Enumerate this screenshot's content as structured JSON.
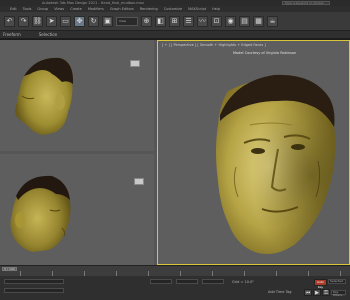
{
  "window": {
    "title": "Autodesk 3ds Max Design 2011 - Head_final_mudbox.max",
    "search_placeholder": "Type a keyword or phrase"
  },
  "menubar": [
    "Edit",
    "Tools",
    "Group",
    "Views",
    "Create",
    "Modifiers",
    "Graph Editors",
    "Rendering",
    "Customize",
    "MAXScript",
    "Help"
  ],
  "toolbar": {
    "view_dropdown": "View"
  },
  "ribbon": {
    "tab_freeform": "Freeform",
    "tab_selection": "Selection"
  },
  "viewports": {
    "main_label": "[ + ] [ Perspective ] [ Smooth + Highlights + Edged Faces ]",
    "credit": "Model Courtesy of Virginia Robinson"
  },
  "timeline": {
    "frame": "0 / 100"
  },
  "status": {
    "grid": "Grid = 10.0\"",
    "add_time_tag": "Add Time Tag",
    "auto_key": "Auto Key",
    "set_key": "Set Key",
    "selected": "Selected",
    "key_filters": "Key Filters..."
  },
  "colors": {
    "active_viewport_border": "#d9c53b",
    "auto_key": "#a83a2a"
  }
}
